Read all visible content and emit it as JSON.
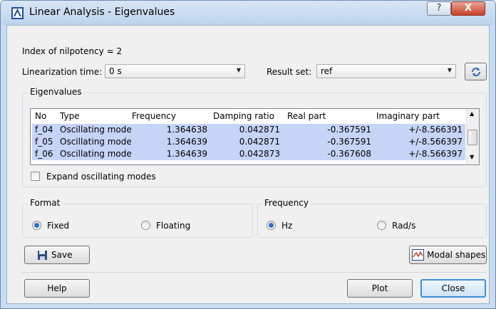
{
  "window": {
    "title": "Linear Analysis - Eigenvalues",
    "help_glyph": "?",
    "close_glyph": "X"
  },
  "info": {
    "nilpotency": "Index of nilpotency = 2"
  },
  "linearization": {
    "label": "Linearization time:",
    "value": "0 s"
  },
  "result_set": {
    "label": "Result set:",
    "value": "ref"
  },
  "eigenvalues": {
    "group_title": "Eigenvalues",
    "columns": [
      "No",
      "Type",
      "Frequency",
      "Damping ratio",
      "Real part",
      "Imaginary part"
    ],
    "rows": [
      [
        "f_04",
        "Oscillating mode",
        "1.364638",
        "0.042871",
        "-0.367591",
        "+/-8.566391"
      ],
      [
        "f_05",
        "Oscillating mode",
        "1.364639",
        "0.042871",
        "-0.367591",
        "+/-8.566397"
      ],
      [
        "f_06",
        "Oscillating mode",
        "1.364639",
        "0.042873",
        "-0.367608",
        "+/-8.566397"
      ]
    ],
    "expand_label": "Expand oscillating modes"
  },
  "format": {
    "title": "Format",
    "fixed": "Fixed",
    "floating": "Floating",
    "selected": "Fixed"
  },
  "frequency": {
    "title": "Frequency",
    "hz": "Hz",
    "rads": "Rad/s",
    "selected": "Hz"
  },
  "buttons": {
    "save": "Save",
    "modal_shapes": "Modal shapes",
    "help": "Help",
    "plot": "Plot",
    "close": "Close"
  },
  "colors": {
    "selection": "#c6d4f7",
    "accent": "#2d6fd3",
    "title_bar": "#c9dcf1"
  }
}
